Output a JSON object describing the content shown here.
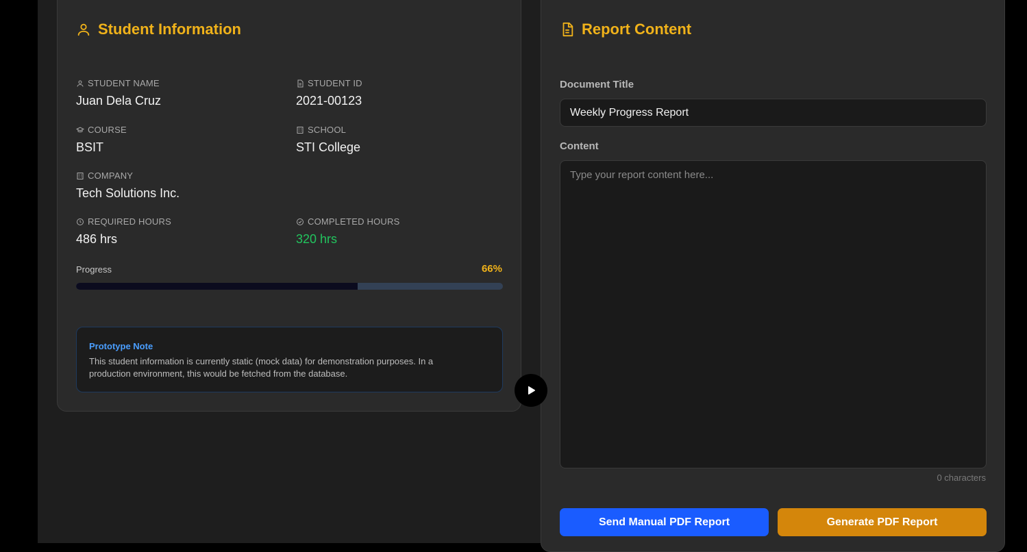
{
  "student_info": {
    "title": "Student Information",
    "fields": {
      "student_name_label": "STUDENT NAME",
      "student_name": "Juan Dela Cruz",
      "student_id_label": "STUDENT ID",
      "student_id": "2021-00123",
      "course_label": "COURSE",
      "course": "BSIT",
      "school_label": "SCHOOL",
      "school": "STI College",
      "company_label": "COMPANY",
      "company": "Tech Solutions Inc.",
      "required_hours_label": "REQUIRED HOURS",
      "required_hours": "486 hrs",
      "completed_hours_label": "COMPLETED HOURS",
      "completed_hours": "320 hrs"
    },
    "progress": {
      "label": "Progress",
      "percent_text": "66%",
      "value": 0.66
    },
    "note": {
      "title": "Prototype Note",
      "body": "This student information is currently static (mock data) for demonstration purposes. In a production environment, this would be fetched from the database."
    },
    "colors": {
      "accent": "#f0b21a",
      "completed": "#22c55e",
      "note_title": "#4a9eff"
    }
  },
  "report": {
    "title": "Report Content",
    "document_title_label": "Document Title",
    "document_title_value": "Weekly Progress Report",
    "content_label": "Content",
    "content_placeholder": "Type your report content here...",
    "char_count": "0 characters",
    "send_button": "Send Manual PDF Report",
    "generate_button": "Generate PDF Report",
    "colors": {
      "send": "#1a5cff",
      "generate": "#d4860b"
    }
  },
  "toggle": {
    "icon": "play-icon"
  }
}
